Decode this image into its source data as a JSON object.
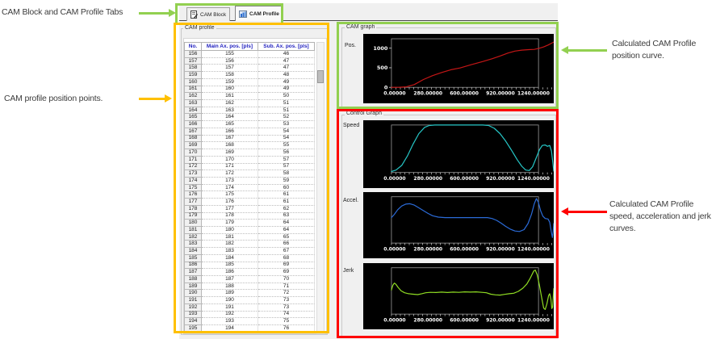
{
  "annotations": {
    "tabs_note": "CAM Block and CAM Profile Tabs",
    "points_note": "CAM profile position points.",
    "pos_note": [
      "Calculated CAM Profile",
      "position curve."
    ],
    "ctrl_note": [
      "Calculated CAM Profile",
      "speed, acceleration and jerk",
      "curves."
    ],
    "green": "#92d050",
    "orange": "#ffc000",
    "red": "#ff0000"
  },
  "window": {
    "tabs": [
      {
        "label": "CAM Block",
        "active": false
      },
      {
        "label": "CAM Profile",
        "active": true
      }
    ],
    "active_tab": "CAM Profile"
  },
  "cam_profile": {
    "group_title": "CAM profile",
    "columns": [
      "No.",
      "Main Ax. pos. [pls]",
      "Sub. Ax. pos. [pls]"
    ],
    "rows": [
      [
        156,
        155,
        46
      ],
      [
        157,
        156,
        47
      ],
      [
        158,
        157,
        47
      ],
      [
        159,
        158,
        48
      ],
      [
        160,
        159,
        49
      ],
      [
        161,
        160,
        49
      ],
      [
        162,
        161,
        50
      ],
      [
        163,
        162,
        51
      ],
      [
        164,
        163,
        51
      ],
      [
        165,
        164,
        52
      ],
      [
        166,
        165,
        53
      ],
      [
        167,
        166,
        54
      ],
      [
        168,
        167,
        54
      ],
      [
        169,
        168,
        55
      ],
      [
        170,
        169,
        56
      ],
      [
        171,
        170,
        57
      ],
      [
        172,
        171,
        57
      ],
      [
        173,
        172,
        58
      ],
      [
        174,
        173,
        59
      ],
      [
        175,
        174,
        60
      ],
      [
        176,
        175,
        61
      ],
      [
        177,
        176,
        61
      ],
      [
        178,
        177,
        62
      ],
      [
        179,
        178,
        63
      ],
      [
        180,
        179,
        64
      ],
      [
        181,
        180,
        64
      ],
      [
        182,
        181,
        65
      ],
      [
        183,
        182,
        66
      ],
      [
        184,
        183,
        67
      ],
      [
        185,
        184,
        68
      ],
      [
        186,
        185,
        69
      ],
      [
        187,
        186,
        69
      ],
      [
        188,
        187,
        70
      ],
      [
        189,
        188,
        71
      ],
      [
        190,
        189,
        72
      ],
      [
        191,
        190,
        73
      ],
      [
        192,
        191,
        73
      ],
      [
        193,
        192,
        74
      ],
      [
        194,
        193,
        75
      ],
      [
        195,
        194,
        76
      ]
    ]
  },
  "cam_graph": {
    "group_title": "CAM graph"
  },
  "control_graph": {
    "group_title": "Control Graph"
  },
  "chart_data": [
    {
      "id": "pos",
      "type": "line",
      "title": "Pos.",
      "color": "#c41616",
      "xmax": 1420,
      "ymax": 1240,
      "x_ticks": [
        "0.00000",
        "280.00000",
        "600.00000",
        "920.00000",
        "1240.00000"
      ],
      "x_tick_vals": [
        0,
        280,
        600,
        920,
        1240
      ],
      "y_ticks": [
        {
          "label": "1000",
          "v": 1000
        },
        {
          "label": "500",
          "v": 500
        },
        {
          "label": "0",
          "v": 0
        }
      ],
      "points": [
        [
          0,
          0
        ],
        [
          70,
          2
        ],
        [
          130,
          12
        ],
        [
          200,
          70
        ],
        [
          280,
          200
        ],
        [
          360,
          300
        ],
        [
          440,
          380
        ],
        [
          520,
          450
        ],
        [
          600,
          495
        ],
        [
          700,
          580
        ],
        [
          800,
          660
        ],
        [
          880,
          730
        ],
        [
          950,
          800
        ],
        [
          1020,
          875
        ],
        [
          1080,
          925
        ],
        [
          1140,
          950
        ],
        [
          1200,
          962
        ],
        [
          1250,
          968
        ],
        [
          1290,
          995
        ],
        [
          1330,
          1030
        ],
        [
          1370,
          1080
        ],
        [
          1420,
          1155
        ]
      ]
    },
    {
      "id": "speed",
      "type": "line",
      "title": "Speed",
      "color": "#26c6c6",
      "xmax": 1420,
      "ymax": 1,
      "x_ticks": [
        "0.00000",
        "280.00000",
        "600.00000",
        "920.00000",
        "1240.00000"
      ],
      "x_tick_vals": [
        0,
        280,
        600,
        920,
        1240
      ],
      "points": [
        [
          0,
          0.02
        ],
        [
          40,
          0.05
        ],
        [
          90,
          0.15
        ],
        [
          140,
          0.35
        ],
        [
          190,
          0.6
        ],
        [
          240,
          0.82
        ],
        [
          290,
          0.95
        ],
        [
          330,
          0.99
        ],
        [
          380,
          1.0
        ],
        [
          800,
          1.0
        ],
        [
          850,
          0.99
        ],
        [
          900,
          0.93
        ],
        [
          950,
          0.82
        ],
        [
          1000,
          0.66
        ],
        [
          1050,
          0.47
        ],
        [
          1100,
          0.27
        ],
        [
          1140,
          0.13
        ],
        [
          1175,
          0.05
        ],
        [
          1205,
          0.04
        ],
        [
          1235,
          0.12
        ],
        [
          1265,
          0.3
        ],
        [
          1295,
          0.48
        ],
        [
          1320,
          0.57
        ],
        [
          1345,
          0.58
        ],
        [
          1365,
          0.55
        ],
        [
          1385,
          0.57
        ],
        [
          1400,
          0.45
        ],
        [
          1412,
          0.2
        ],
        [
          1420,
          0.03
        ]
      ]
    },
    {
      "id": "accel",
      "type": "line",
      "title": "Accel.",
      "color": "#2b6bd8",
      "xmax": 1420,
      "ymax": 1,
      "x_ticks": [
        "0.00000",
        "280.00000",
        "600.00000",
        "920.00000",
        "1240.00000"
      ],
      "x_tick_vals": [
        0,
        280,
        600,
        920,
        1240
      ],
      "points": [
        [
          0,
          0.55
        ],
        [
          25,
          0.62
        ],
        [
          55,
          0.72
        ],
        [
          90,
          0.8
        ],
        [
          125,
          0.84
        ],
        [
          160,
          0.85
        ],
        [
          200,
          0.82
        ],
        [
          240,
          0.76
        ],
        [
          280,
          0.7
        ],
        [
          320,
          0.64
        ],
        [
          360,
          0.59
        ],
        [
          410,
          0.56
        ],
        [
          470,
          0.55
        ],
        [
          840,
          0.55
        ],
        [
          880,
          0.53
        ],
        [
          920,
          0.49
        ],
        [
          960,
          0.43
        ],
        [
          1000,
          0.36
        ],
        [
          1040,
          0.3
        ],
        [
          1080,
          0.26
        ],
        [
          1120,
          0.25
        ],
        [
          1160,
          0.29
        ],
        [
          1195,
          0.42
        ],
        [
          1225,
          0.62
        ],
        [
          1250,
          0.85
        ],
        [
          1268,
          0.96
        ],
        [
          1285,
          0.88
        ],
        [
          1305,
          0.7
        ],
        [
          1325,
          0.58
        ],
        [
          1345,
          0.53
        ],
        [
          1370,
          0.52
        ],
        [
          1385,
          0.45
        ],
        [
          1398,
          0.25
        ],
        [
          1408,
          0.12
        ],
        [
          1415,
          0.25
        ],
        [
          1420,
          0.42
        ]
      ]
    },
    {
      "id": "jerk",
      "type": "line",
      "title": "Jerk",
      "color": "#8fdc23",
      "xmax": 1420,
      "ymax": 1,
      "x_ticks": [
        "0.00000",
        "280.00000",
        "600.00000",
        "920.00000",
        "1240.00000"
      ],
      "x_tick_vals": [
        0,
        280,
        600,
        920,
        1240
      ],
      "points": [
        [
          0,
          0.52
        ],
        [
          12,
          0.62
        ],
        [
          25,
          0.67
        ],
        [
          40,
          0.64
        ],
        [
          60,
          0.57
        ],
        [
          85,
          0.5
        ],
        [
          115,
          0.46
        ],
        [
          150,
          0.44
        ],
        [
          190,
          0.43
        ],
        [
          230,
          0.42
        ],
        [
          265,
          0.44
        ],
        [
          300,
          0.46
        ],
        [
          340,
          0.47
        ],
        [
          390,
          0.465
        ],
        [
          440,
          0.475
        ],
        [
          490,
          0.465
        ],
        [
          540,
          0.475
        ],
        [
          590,
          0.47
        ],
        [
          640,
          0.48
        ],
        [
          690,
          0.475
        ],
        [
          740,
          0.48
        ],
        [
          790,
          0.47
        ],
        [
          830,
          0.46
        ],
        [
          870,
          0.43
        ],
        [
          910,
          0.415
        ],
        [
          950,
          0.41
        ],
        [
          990,
          0.425
        ],
        [
          1030,
          0.44
        ],
        [
          1070,
          0.45
        ],
        [
          1110,
          0.49
        ],
        [
          1150,
          0.56
        ],
        [
          1185,
          0.65
        ],
        [
          1215,
          0.78
        ],
        [
          1245,
          0.93
        ],
        [
          1258,
          0.95
        ],
        [
          1275,
          0.85
        ],
        [
          1295,
          0.62
        ],
        [
          1315,
          0.35
        ],
        [
          1332,
          0.13
        ],
        [
          1345,
          0.1
        ],
        [
          1360,
          0.22
        ],
        [
          1375,
          0.4
        ],
        [
          1385,
          0.44
        ],
        [
          1395,
          0.32
        ],
        [
          1403,
          0.12
        ],
        [
          1410,
          0.15
        ],
        [
          1418,
          0.45
        ],
        [
          1420,
          0.55
        ]
      ]
    }
  ]
}
